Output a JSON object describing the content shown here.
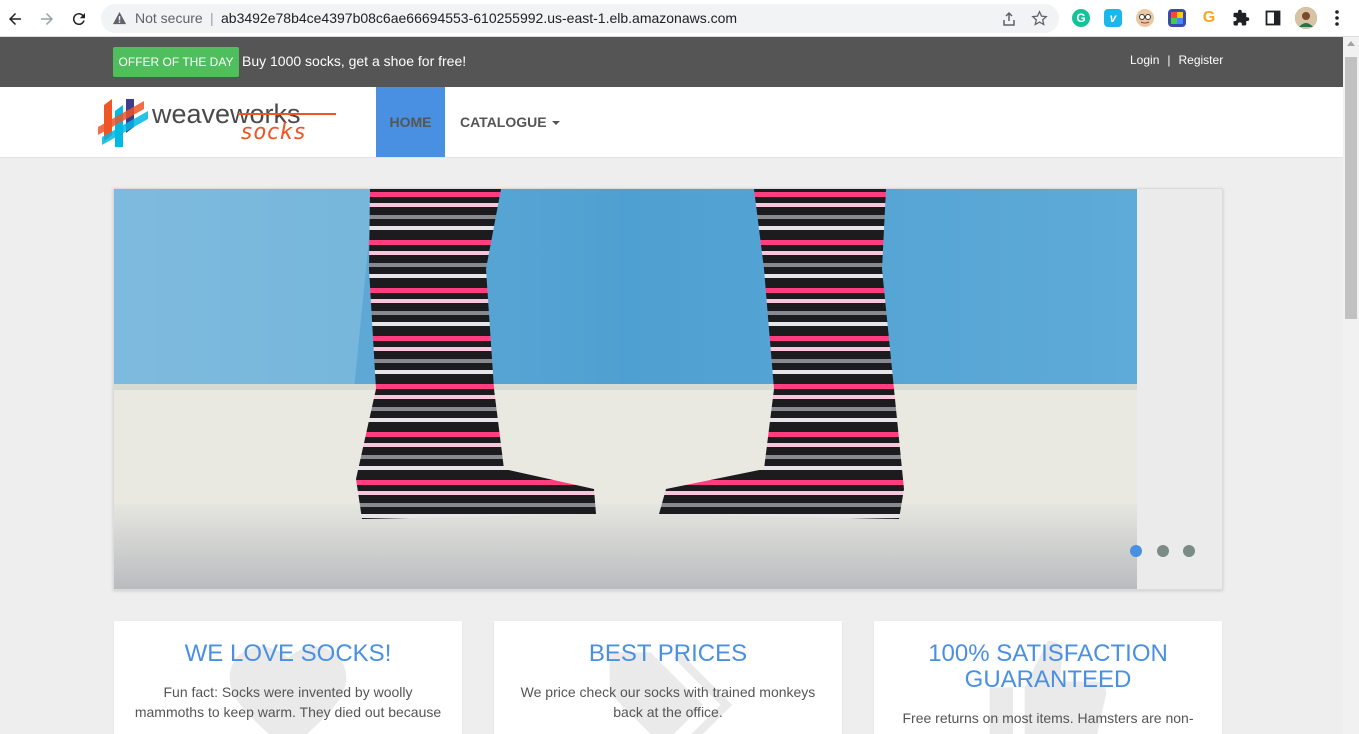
{
  "browser": {
    "security_label": "Not secure",
    "separator": "|",
    "url": "ab3492e78b4ce4397b08c6ae66694553-610255992.us-east-1.elb.amazonaws.com",
    "extensions": [
      {
        "name": "grammarly-extension",
        "glyph": "G",
        "color": "#15c39a"
      },
      {
        "name": "vimeo-extension",
        "glyph": "v",
        "color": "#1ab7ea"
      },
      {
        "name": "face-extension",
        "glyph": "",
        "color": "#c97a4a"
      },
      {
        "name": "colorful-extension",
        "glyph": "",
        "color": "#3a4ca8"
      },
      {
        "name": "g-orange-extension",
        "glyph": "G",
        "color": "#f6a623"
      }
    ]
  },
  "topbar": {
    "offer_button": "OFFER OF THE DAY",
    "offer_text": "Buy 1000 socks, get a shoe for free!",
    "login": "Login",
    "divider": "|",
    "register": "Register"
  },
  "navbar": {
    "logo_text_main": "weaveworks",
    "logo_text_sub": "socks",
    "home": "HOME",
    "catalogue": "CATALOGUE"
  },
  "carousel": {
    "active_index": 0,
    "slide_count": 3
  },
  "features": [
    {
      "title": "WE LOVE SOCKS!",
      "text": "Fun fact: Socks were invented by woolly mammoths to keep warm. They died out because"
    },
    {
      "title": "BEST PRICES",
      "text": "We price check our socks with trained monkeys back at the office."
    },
    {
      "title": "100% SATISFACTION GUARANTEED",
      "text": "Free returns on most items. Hamsters are non-"
    }
  ],
  "colors": {
    "accent": "#4a90e2",
    "offer_green": "#4fbe5c",
    "topbar": "#555555",
    "dot_active": "#4a90e2",
    "dot_inactive": "#7b8c87"
  }
}
